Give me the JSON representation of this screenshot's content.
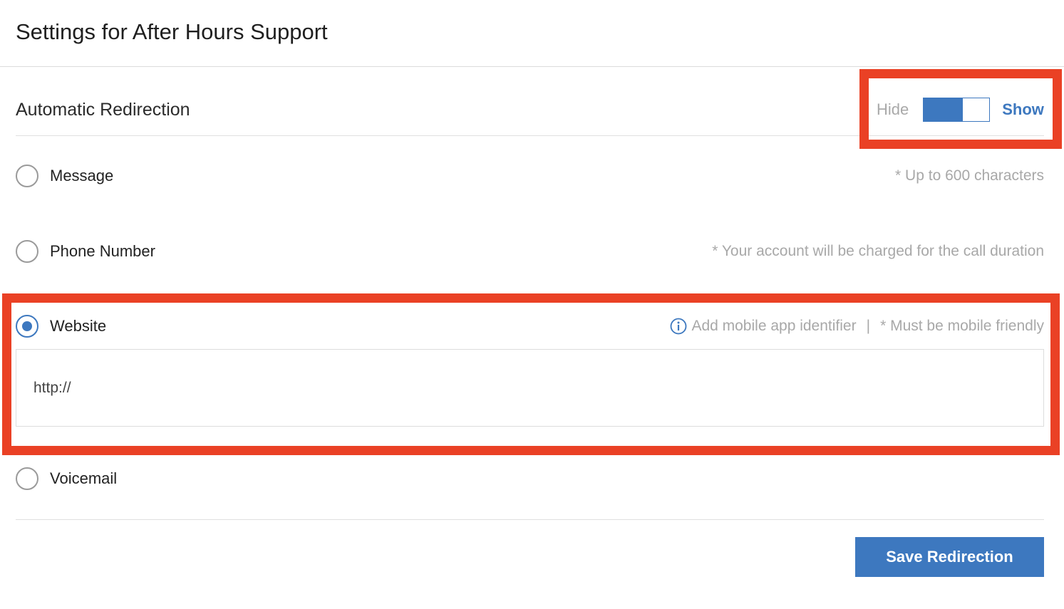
{
  "page": {
    "title": "Settings for After Hours Support"
  },
  "section": {
    "title": "Automatic Redirection",
    "toggle": {
      "off_label": "Hide",
      "on_label": "Show",
      "state": "on"
    }
  },
  "options": {
    "message": {
      "label": "Message",
      "hint": "* Up to 600 characters",
      "selected": false
    },
    "phone": {
      "label": "Phone Number",
      "hint": "* Your account will be charged for the call duration",
      "selected": false
    },
    "website": {
      "label": "Website",
      "info_link": "Add mobile app identifier",
      "separator": "|",
      "hint": "* Must be mobile friendly",
      "input_value": "http://",
      "selected": true
    },
    "voicemail": {
      "label": "Voicemail",
      "selected": false
    }
  },
  "footer": {
    "save_label": "Save Redirection"
  },
  "colors": {
    "accent": "#3d78bf",
    "highlight": "#ea4125",
    "hint_text": "#a8a8a8"
  },
  "icons": {
    "info": "info-circle-icon"
  }
}
